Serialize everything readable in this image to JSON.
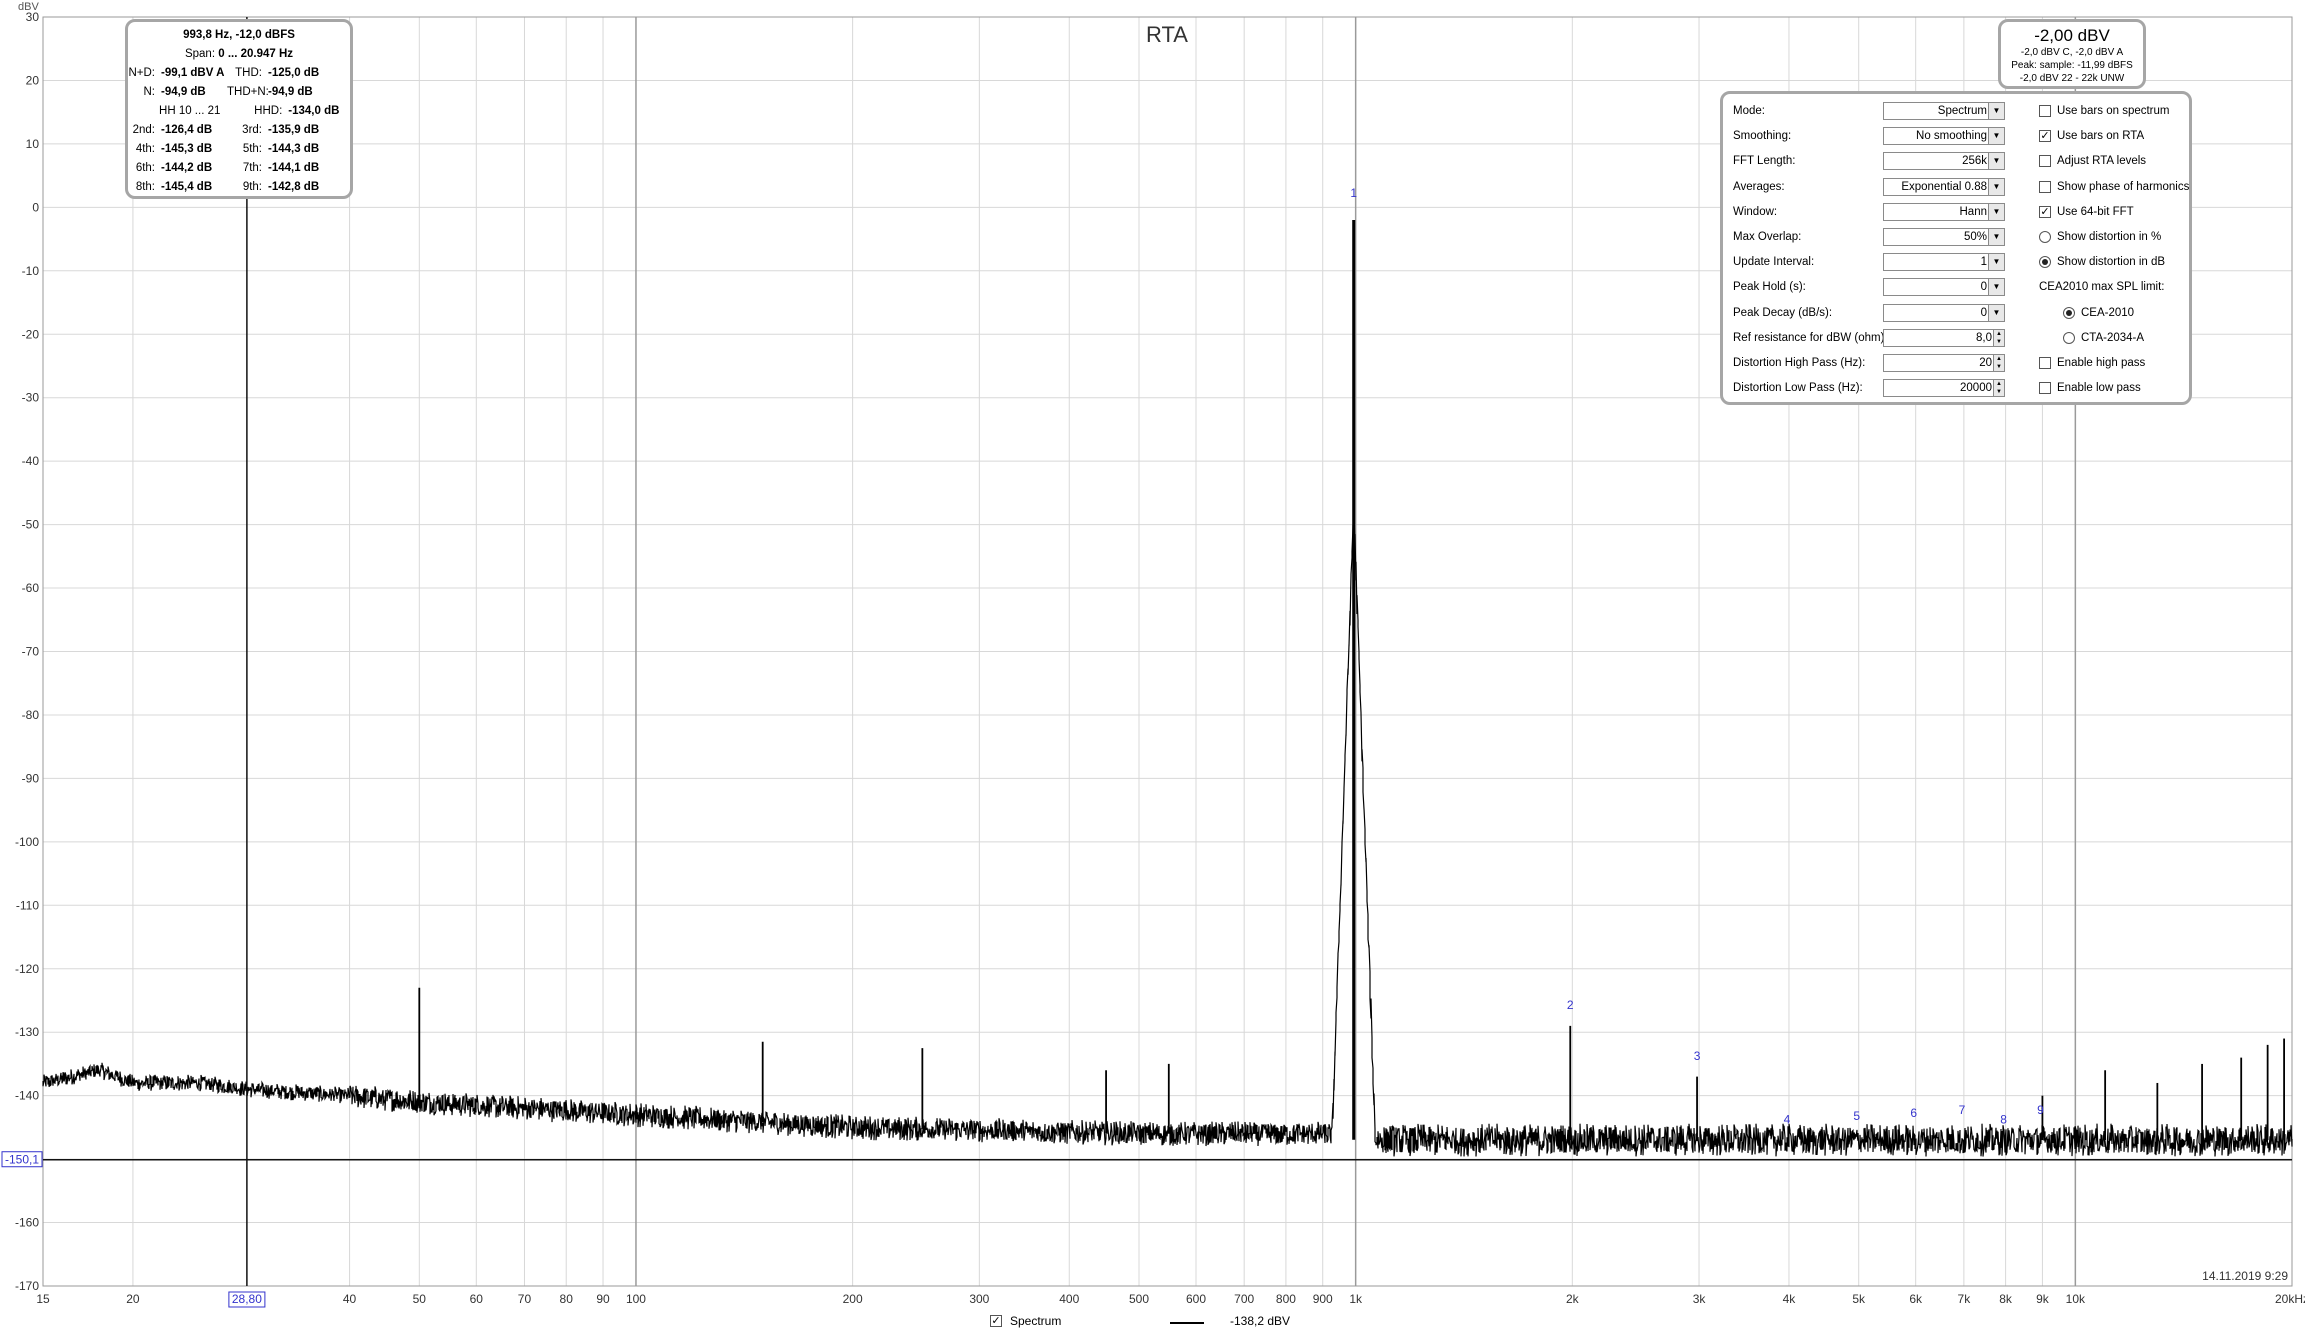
{
  "chart_data": {
    "type": "line",
    "title": "RTA",
    "ylabel": "dBV",
    "x_scale": "log",
    "xlim": [
      15,
      20000
    ],
    "ylim": [
      -170,
      30
    ],
    "grid": true,
    "x_ticks": [
      {
        "v": 15,
        "label": "15"
      },
      {
        "v": 20,
        "label": "20"
      },
      {
        "v": 40,
        "label": "40"
      },
      {
        "v": 50,
        "label": "50"
      },
      {
        "v": 60,
        "label": "60"
      },
      {
        "v": 70,
        "label": "70"
      },
      {
        "v": 80,
        "label": "80"
      },
      {
        "v": 90,
        "label": "90"
      },
      {
        "v": 100,
        "label": "100"
      },
      {
        "v": 200,
        "label": "200"
      },
      {
        "v": 300,
        "label": "300"
      },
      {
        "v": 400,
        "label": "400"
      },
      {
        "v": 500,
        "label": "500"
      },
      {
        "v": 600,
        "label": "600"
      },
      {
        "v": 700,
        "label": "700"
      },
      {
        "v": 800,
        "label": "800"
      },
      {
        "v": 900,
        "label": "900"
      },
      {
        "v": 1000,
        "label": "1k"
      },
      {
        "v": 2000,
        "label": "2k"
      },
      {
        "v": 3000,
        "label": "3k"
      },
      {
        "v": 4000,
        "label": "4k"
      },
      {
        "v": 5000,
        "label": "5k"
      },
      {
        "v": 6000,
        "label": "6k"
      },
      {
        "v": 7000,
        "label": "7k"
      },
      {
        "v": 8000,
        "label": "8k"
      },
      {
        "v": 9000,
        "label": "9k"
      },
      {
        "v": 10000,
        "label": "10k"
      },
      {
        "v": 20000,
        "label": "20kHz"
      }
    ],
    "y_ticks": [
      30,
      20,
      10,
      0,
      -10,
      -20,
      -30,
      -40,
      -50,
      -60,
      -70,
      -80,
      -90,
      -100,
      -110,
      -120,
      -130,
      -140,
      -150,
      -160,
      -170
    ],
    "noise_floor": [
      [
        15,
        -138
      ],
      [
        18,
        -136
      ],
      [
        20,
        -138
      ],
      [
        25,
        -138
      ],
      [
        28.8,
        -139
      ],
      [
        40,
        -140
      ],
      [
        50,
        -141
      ],
      [
        100,
        -143
      ],
      [
        200,
        -145
      ],
      [
        500,
        -146
      ],
      [
        900,
        -146
      ],
      [
        1000,
        -147
      ],
      [
        2000,
        -147
      ],
      [
        5000,
        -147
      ],
      [
        10000,
        -147
      ],
      [
        20000,
        -147
      ]
    ],
    "spikes": [
      {
        "f": 50,
        "db": -123
      },
      {
        "f": 150,
        "db": -131.5
      },
      {
        "f": 250,
        "db": -132.5
      },
      {
        "f": 450,
        "db": -136
      },
      {
        "f": 550,
        "db": -135
      },
      {
        "f": 993.8,
        "db": -2
      },
      {
        "f": 1987,
        "db": -129
      },
      {
        "f": 2981,
        "db": -137
      },
      {
        "f": 9000,
        "db": -140
      },
      {
        "f": 11000,
        "db": -136
      },
      {
        "f": 13000,
        "db": -138
      },
      {
        "f": 15000,
        "db": -135
      },
      {
        "f": 17000,
        "db": -134
      },
      {
        "f": 18500,
        "db": -132
      },
      {
        "f": 19500,
        "db": -131
      }
    ],
    "harmonic_markers": [
      {
        "f": 993.8,
        "db": 1,
        "label": "1"
      },
      {
        "f": 1987,
        "db": -127,
        "label": "2"
      },
      {
        "f": 2981,
        "db": -135,
        "label": "3"
      },
      {
        "f": 3975,
        "db": -145,
        "label": "4"
      },
      {
        "f": 4969,
        "db": -144.5,
        "label": "5"
      },
      {
        "f": 5963,
        "db": -144,
        "label": "6"
      },
      {
        "f": 6957,
        "db": -143.5,
        "label": "7"
      },
      {
        "f": 7950,
        "db": -145,
        "label": "8"
      },
      {
        "f": 8944,
        "db": -143.5,
        "label": "9"
      }
    ],
    "cursor": {
      "x": 28.8,
      "y": -150.1,
      "x_label": "28,80",
      "y_label": "-150,1"
    },
    "timestamp": "14.11.2019 9:29",
    "series": [
      {
        "name": "Spectrum",
        "cursor_value": "-138,2 dBV",
        "color": "#000000"
      }
    ]
  },
  "harmonics_panel": {
    "header": "993,8 Hz, -12,0 dBFS",
    "span_label": "Span:",
    "span_value": "0 ... 20.947 Hz",
    "rows": [
      [
        "N+D:",
        "-99,1 dBV A",
        "THD:",
        "-125,0 dB"
      ],
      [
        "N:",
        "-94,9 dB",
        "THD+N:",
        "-94,9 dB"
      ],
      [
        "HH 10 ... 21",
        "",
        "HHD:",
        "-134,0 dB"
      ],
      [
        "2nd:",
        "-126,4 dB",
        "3rd:",
        "-135,9 dB"
      ],
      [
        "4th:",
        "-145,3 dB",
        "5th:",
        "-144,3 dB"
      ],
      [
        "6th:",
        "-144,2 dB",
        "7th:",
        "-144,1 dB"
      ],
      [
        "8th:",
        "-145,4 dB",
        "9th:",
        "-142,8 dB"
      ]
    ]
  },
  "level_panel": {
    "main": "-2,00 dBV",
    "line1": "-2,0 dBV C, -2,0 dBV A",
    "line2": "Peak: sample: -11,99 dBFS",
    "line3": "-2,0 dBV 22 - 22k UNW"
  },
  "controls": [
    {
      "label": "Mode:",
      "value": "Spectrum",
      "kind": "dropdown",
      "opt": {
        "kind": "checkbox",
        "label": "Use bars on spectrum",
        "checked": false
      }
    },
    {
      "label": "Smoothing:",
      "value": "No  smoothing",
      "kind": "dropdown",
      "opt": {
        "kind": "checkbox",
        "label": "Use bars on RTA",
        "checked": true
      }
    },
    {
      "label": "FFT Length:",
      "value": "256k",
      "kind": "dropdown",
      "opt": {
        "kind": "checkbox",
        "label": "Adjust RTA levels",
        "checked": false
      }
    },
    {
      "label": "Averages:",
      "value": "Exponential 0.88",
      "kind": "dropdown",
      "opt": {
        "kind": "checkbox",
        "label": "Show phase of harmonics",
        "checked": false
      }
    },
    {
      "label": "Window:",
      "value": "Hann",
      "kind": "dropdown",
      "opt": {
        "kind": "checkbox",
        "label": "Use 64-bit FFT",
        "checked": true
      }
    },
    {
      "label": "Max Overlap:",
      "value": "50%",
      "kind": "dropdown",
      "opt": {
        "kind": "radio",
        "label": "Show distortion in %",
        "checked": false
      }
    },
    {
      "label": "Update Interval:",
      "value": "1",
      "kind": "dropdown",
      "opt": {
        "kind": "radio",
        "label": "Show distortion in dB",
        "checked": true
      }
    },
    {
      "label": "Peak Hold (s):",
      "value": "0",
      "kind": "dropdown",
      "opt": {
        "kind": "text",
        "label": "CEA2010 max SPL limit:"
      }
    },
    {
      "label": "Peak Decay (dB/s):",
      "value": "0",
      "kind": "dropdown",
      "opt": {
        "kind": "radio-indent",
        "label": "CEA-2010",
        "checked": true
      }
    },
    {
      "label": "Ref resistance for dBW (ohm):",
      "value": "8,0",
      "kind": "spin",
      "opt": {
        "kind": "radio-indent",
        "label": "CTA-2034-A",
        "checked": false
      }
    },
    {
      "label": "Distortion High Pass (Hz):",
      "value": "20",
      "kind": "spin",
      "opt": {
        "kind": "checkbox",
        "label": "Enable high pass",
        "checked": false
      }
    },
    {
      "label": "Distortion Low Pass (Hz):",
      "value": "20000",
      "kind": "spin",
      "opt": {
        "kind": "checkbox",
        "label": "Enable low pass",
        "checked": false
      }
    }
  ],
  "icons": {
    "check": "✓",
    "arrow_down": "▼",
    "spin_up": "▲",
    "spin_down": "▼"
  }
}
